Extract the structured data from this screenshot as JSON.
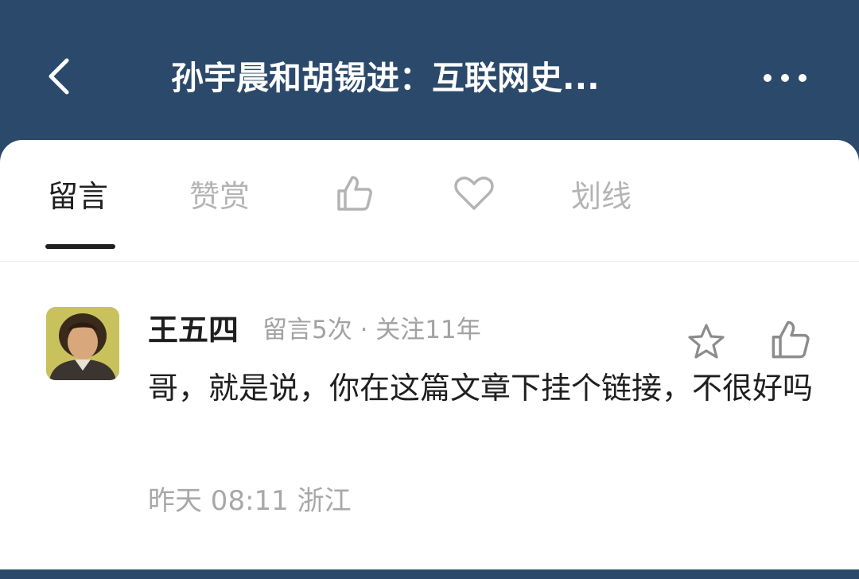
{
  "header": {
    "title": "孙宇晨和胡锡进：互联网史...",
    "back_icon": "chevron-left-icon",
    "more_icon": "more-horizontal-icon"
  },
  "tabs": {
    "comments_label": "留言",
    "reward_label": "赞赏",
    "like_icon": "thumbs-up-icon",
    "heart_icon": "heart-icon",
    "highlight_label": "划线"
  },
  "comment": {
    "user_name": "王五四",
    "user_meta": "留言5次 · 关注11年",
    "text": "哥，就是说，你在这篇文章下挂个链接，不很好吗",
    "time": "昨天 08:11  浙江",
    "star_icon": "star-icon",
    "like_icon": "thumbs-up-icon"
  },
  "colors": {
    "header_bg": "#2b4a6b",
    "active_tab": "#1f1f1f",
    "inactive_tab": "#b4b4b4"
  }
}
